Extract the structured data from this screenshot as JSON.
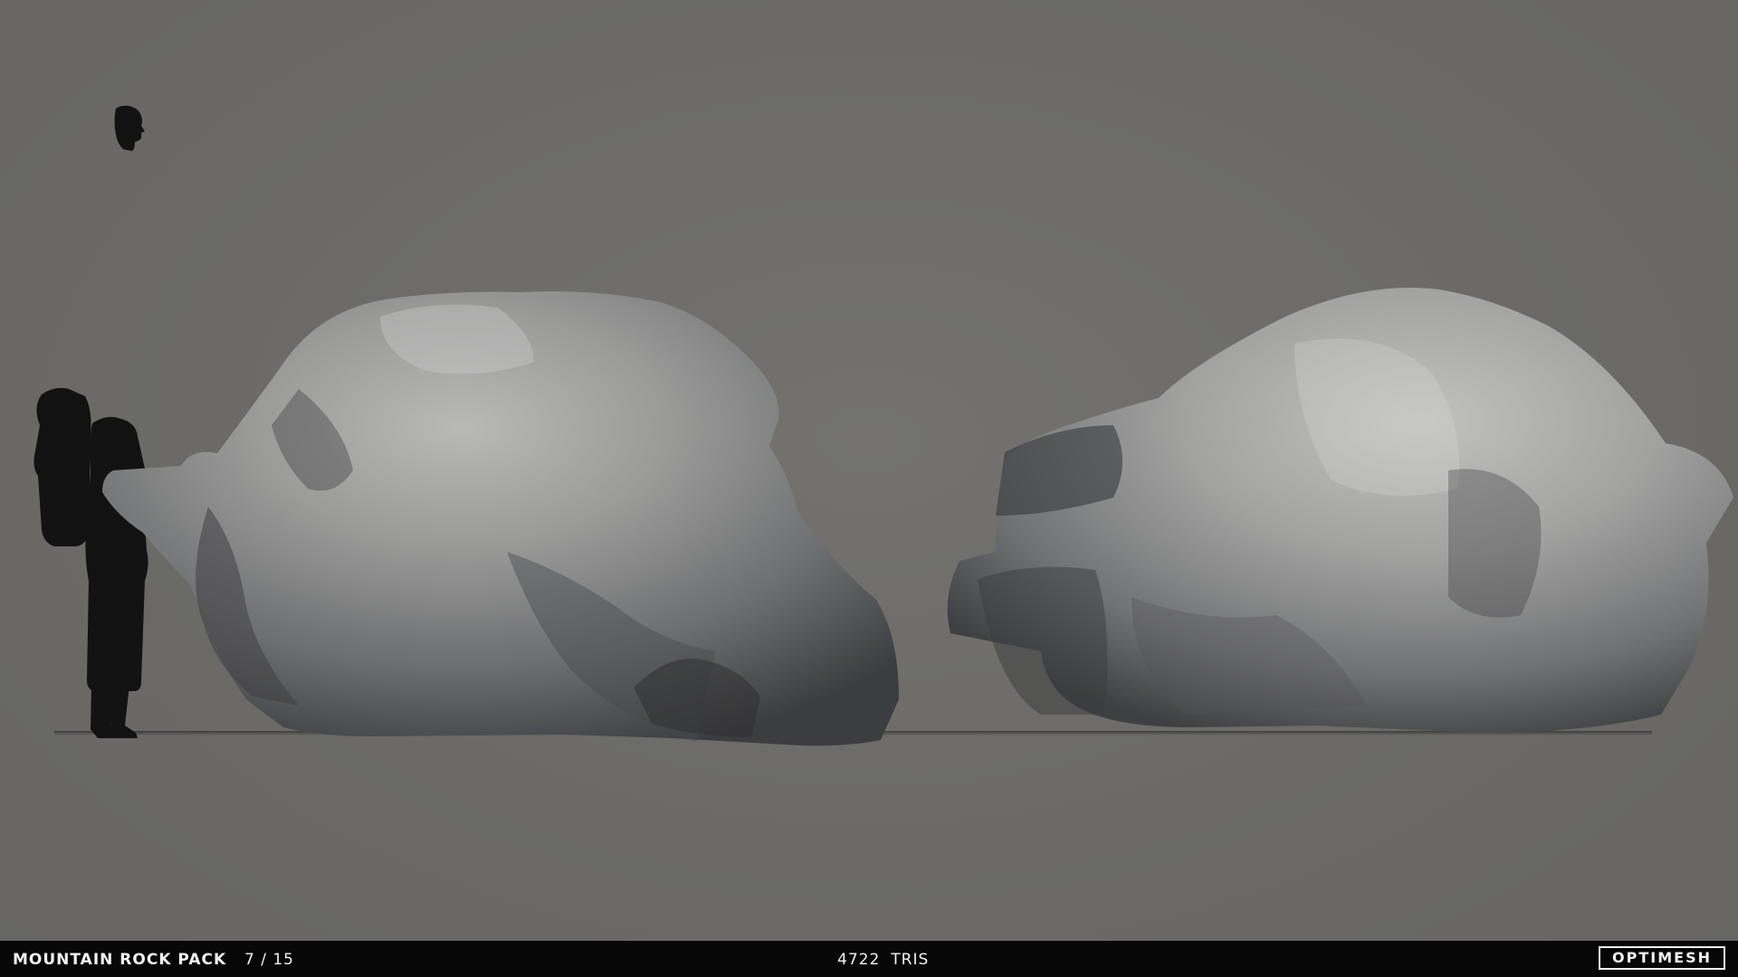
{
  "footer": {
    "pack_title": "MOUNTAIN ROCK PACK",
    "page_counter": "7 / 15",
    "tri_count": "4722",
    "tri_unit": "TRIS",
    "brand": "OPTIMESH"
  },
  "scene": {
    "background_color": "#6b6a66",
    "objects": [
      "human-scale-silhouette",
      "left-boulder",
      "right-boulder"
    ]
  }
}
